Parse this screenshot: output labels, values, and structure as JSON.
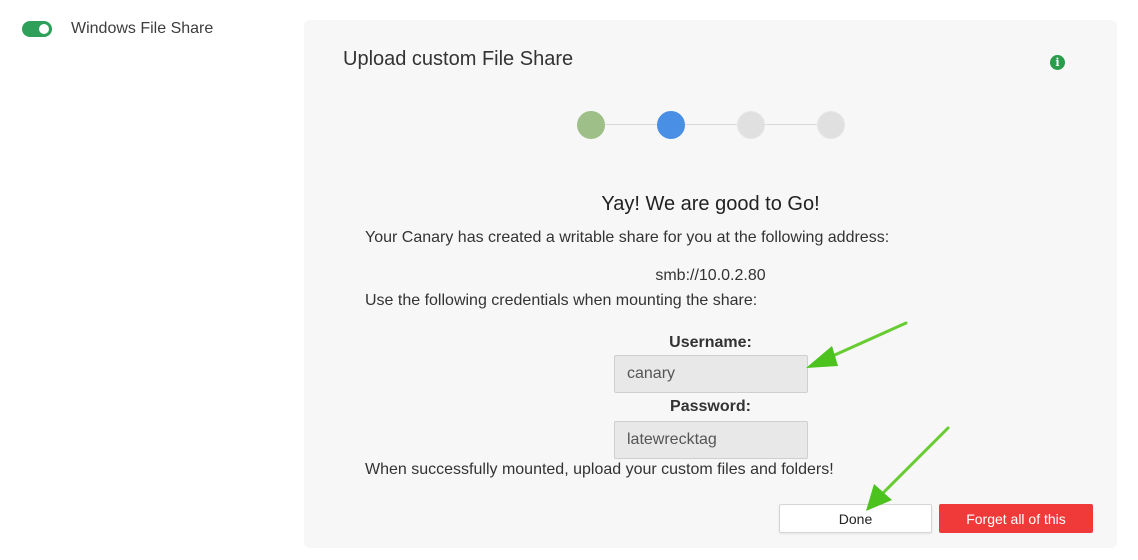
{
  "sidebar": {
    "service_label": "Windows File Share",
    "toggle_on": true
  },
  "panel": {
    "title": "Upload custom File Share",
    "info_icon": "info-icon",
    "steps": [
      {
        "state": "done"
      },
      {
        "state": "active"
      },
      {
        "state": "pending"
      },
      {
        "state": "pending"
      }
    ],
    "heading": "Yay! We are good to Go!",
    "intro_text": "Your Canary has created a writable share for you at the following address:",
    "address": "smb://10.0.2.80",
    "credentials_text": "Use the following credentials when mounting the share:",
    "username_label": "Username:",
    "username_value": "canary",
    "password_label": "Password:",
    "password_value": "latewrecktag",
    "upload_text": "When successfully mounted, upload your custom files and folders!"
  },
  "buttons": {
    "done_label": "Done",
    "forget_label": "Forget all of this"
  },
  "colors": {
    "toggle_green": "#2fa05a",
    "step_done": "#9fbf88",
    "step_active": "#4a8fe6",
    "step_pending": "#e0e0e0",
    "danger": "#f03a3a",
    "annotation_arrow": "#5ecb1c"
  }
}
